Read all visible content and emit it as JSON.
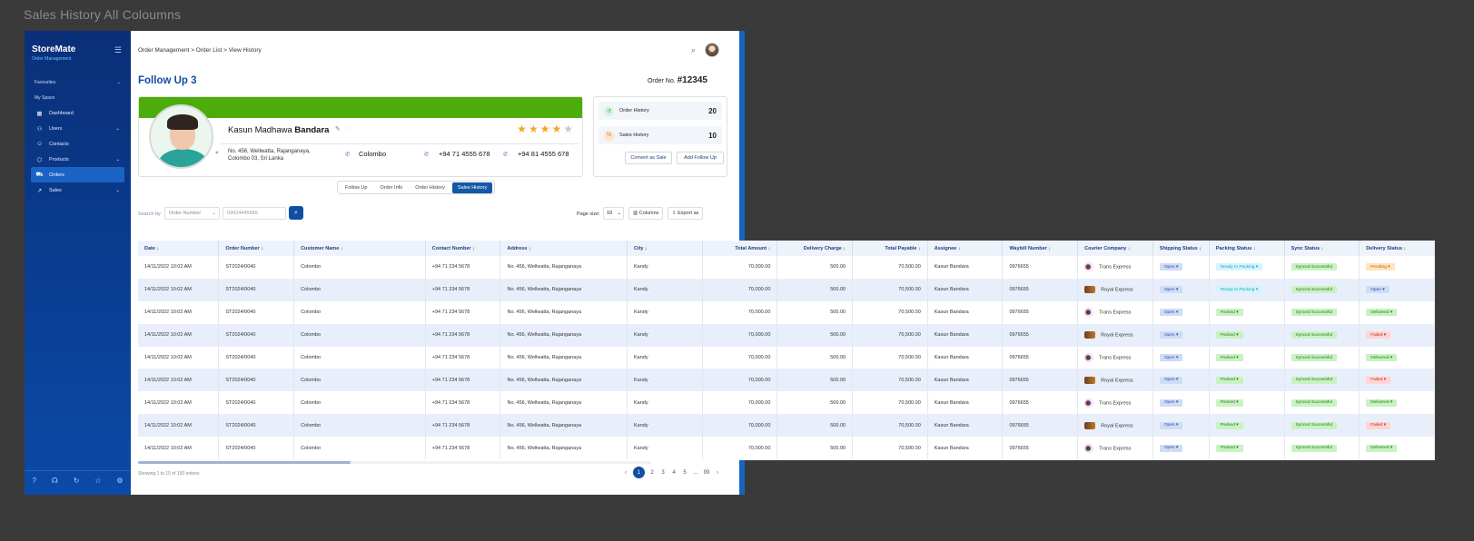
{
  "canvas_title": "Sales History  All Coloumns",
  "sidebar": {
    "brand": "StoreMate",
    "brand_sub": "Order Management",
    "favourites": "Favourites",
    "my_space": "My Space",
    "items": [
      {
        "label": "Dashboard",
        "icon": "grid-icon"
      },
      {
        "label": "Users",
        "icon": "user-icon"
      },
      {
        "label": "Contacts",
        "icon": "contacts-icon"
      },
      {
        "label": "Products",
        "icon": "box-icon"
      },
      {
        "label": "Orders",
        "icon": "cart-icon"
      },
      {
        "label": "Sales",
        "icon": "trend-icon"
      }
    ]
  },
  "breadcrumb": [
    "Order Management",
    "Order List",
    "View History"
  ],
  "page_title": "Follow Up 3",
  "order_no_label": "Order No.",
  "order_no": "#12345",
  "customer": {
    "first": "Kasun Madhawa",
    "last": "Bandara",
    "rating": 4,
    "address_line1": "No. 456, Wellwatta, Rajanganaya,",
    "address_line2": "Colombo 03, Sri Lanka",
    "city": "Colombo",
    "phone1": "+94 71 4555 678",
    "phone2": "+94 81 4555 678"
  },
  "history": {
    "order_label": "Order History",
    "order_count": "20",
    "sales_label": "Sales History",
    "sales_count": "10",
    "convert_btn": "Convert as Sale",
    "add_btn": "Add Follow Up"
  },
  "tabs": [
    "Follow Up",
    "Order Info",
    "Order History",
    "Sales History"
  ],
  "toolbar": {
    "search_by": "Search by",
    "select_value": "Order Number",
    "search_placeholder": "09024445689",
    "page_size_label": "Page size:",
    "page_size": "10",
    "columns_btn": "Columns",
    "export_btn": "Export as"
  },
  "table": {
    "headers": [
      "Date",
      "Order Number",
      "Customer Name",
      "Contact Number",
      "Address",
      "City",
      "Total Amount",
      "Delivery Charge",
      "Total Payable",
      "Assignee",
      "Waybill Number",
      "Courier Company",
      "Shipping Status",
      "Packing Status",
      "Sync Status",
      "Delivery Status"
    ],
    "rows": [
      {
        "date": "14/11/2022 10:02 AM",
        "order": "ST2024/0040",
        "customer": "Colombo",
        "contact": "+94 71 234 5678",
        "address": "No. 456, Wellwatta, Rajanganaya",
        "city": "Kandy",
        "total": "70,000.00",
        "delivery": "500.00",
        "payable": "70,500.00",
        "assignee": "Kasun Bandara",
        "waybill": "0976655",
        "courier": "Trans Express",
        "shipping": "Open",
        "packing": "Ready to Packing",
        "sync": "Synced Successful",
        "delivery_status": "Pending"
      },
      {
        "date": "14/11/2022 10:02 AM",
        "order": "ST2024/0040",
        "customer": "Colombo",
        "contact": "+94 71 234 5678",
        "address": "No. 456, Wellwatta, Rajanganaya",
        "city": "Kandy",
        "total": "70,000.00",
        "delivery": "500.00",
        "payable": "70,500.00",
        "assignee": "Kasun Bandara",
        "waybill": "0976655",
        "courier": "Royal Express",
        "shipping": "Open",
        "packing": "Ready to Packing",
        "sync": "Synced Successful",
        "delivery_status": "Open"
      },
      {
        "date": "14/11/2022 10:02 AM",
        "order": "ST2024/0040",
        "customer": "Colombo",
        "contact": "+94 71 234 5678",
        "address": "No. 456, Wellwatta, Rajanganaya",
        "city": "Kandy",
        "total": "70,000.00",
        "delivery": "500.00",
        "payable": "70,500.00",
        "assignee": "Kasun Bandara",
        "waybill": "0976655",
        "courier": "Trans Express",
        "shipping": "Open",
        "packing": "Packed",
        "sync": "Synced Successful",
        "delivery_status": "Delivered"
      },
      {
        "date": "14/11/2022 10:02 AM",
        "order": "ST2024/0040",
        "customer": "Colombo",
        "contact": "+94 71 234 5678",
        "address": "No. 456, Wellwatta, Rajanganaya",
        "city": "Kandy",
        "total": "70,000.00",
        "delivery": "500.00",
        "payable": "70,500.00",
        "assignee": "Kasun Bandara",
        "waybill": "0976655",
        "courier": "Royal Express",
        "shipping": "Open",
        "packing": "Packed",
        "sync": "Synced Successful",
        "delivery_status": "Failed"
      },
      {
        "date": "14/11/2022 10:02 AM",
        "order": "ST2024/0040",
        "customer": "Colombo",
        "contact": "+94 71 234 5678",
        "address": "No. 456, Wellwatta, Rajanganaya",
        "city": "Kandy",
        "total": "70,000.00",
        "delivery": "500.00",
        "payable": "70,500.00",
        "assignee": "Kasun Bandara",
        "waybill": "0976655",
        "courier": "Trans Express",
        "shipping": "Open",
        "packing": "Packed",
        "sync": "Synced Successful",
        "delivery_status": "Delivered"
      },
      {
        "date": "14/11/2022 10:02 AM",
        "order": "ST2024/0040",
        "customer": "Colombo",
        "contact": "+94 71 234 5678",
        "address": "No. 456, Wellwatta, Rajanganaya",
        "city": "Kandy",
        "total": "70,000.00",
        "delivery": "500.00",
        "payable": "70,500.00",
        "assignee": "Kasun Bandara",
        "waybill": "0976655",
        "courier": "Royal Express",
        "shipping": "Open",
        "packing": "Packed",
        "sync": "Synced Successful",
        "delivery_status": "Failed"
      },
      {
        "date": "14/11/2022 10:02 AM",
        "order": "ST2024/0040",
        "customer": "Colombo",
        "contact": "+94 71 234 5678",
        "address": "No. 456, Wellwatta, Rajanganaya",
        "city": "Kandy",
        "total": "70,000.00",
        "delivery": "500.00",
        "payable": "70,500.00",
        "assignee": "Kasun Bandara",
        "waybill": "0976655",
        "courier": "Trans Express",
        "shipping": "Open",
        "packing": "Packed",
        "sync": "Synced Successful",
        "delivery_status": "Delivered"
      },
      {
        "date": "14/11/2022 10:02 AM",
        "order": "ST2024/0040",
        "customer": "Colombo",
        "contact": "+94 71 234 5678",
        "address": "No. 456, Wellwatta, Rajanganaya",
        "city": "Kandy",
        "total": "70,000.00",
        "delivery": "500.00",
        "payable": "70,500.00",
        "assignee": "Kasun Bandara",
        "waybill": "0976655",
        "courier": "Royal Express",
        "shipping": "Open",
        "packing": "Packed",
        "sync": "Synced Successful",
        "delivery_status": "Failed"
      },
      {
        "date": "14/11/2022 10:02 AM",
        "order": "ST2024/0040",
        "customer": "Colombo",
        "contact": "+94 71 234 5678",
        "address": "No. 456, Wellwatta, Rajanganaya",
        "city": "Kandy",
        "total": "70,000.00",
        "delivery": "500.00",
        "payable": "70,500.00",
        "assignee": "Kasun Bandara",
        "waybill": "0976655",
        "courier": "Trans Express",
        "shipping": "Open",
        "packing": "Packed",
        "sync": "Synced Successful",
        "delivery_status": "Delivered"
      }
    ]
  },
  "footer": {
    "showing": "Showing 1 to 10 of 150 entries",
    "pages": [
      "1",
      "2",
      "3",
      "4",
      "5",
      "...",
      "99"
    ]
  },
  "colors": {
    "primary": "#0f4ea0",
    "profile_band": "#4cac0a",
    "star": "#f5a623"
  }
}
